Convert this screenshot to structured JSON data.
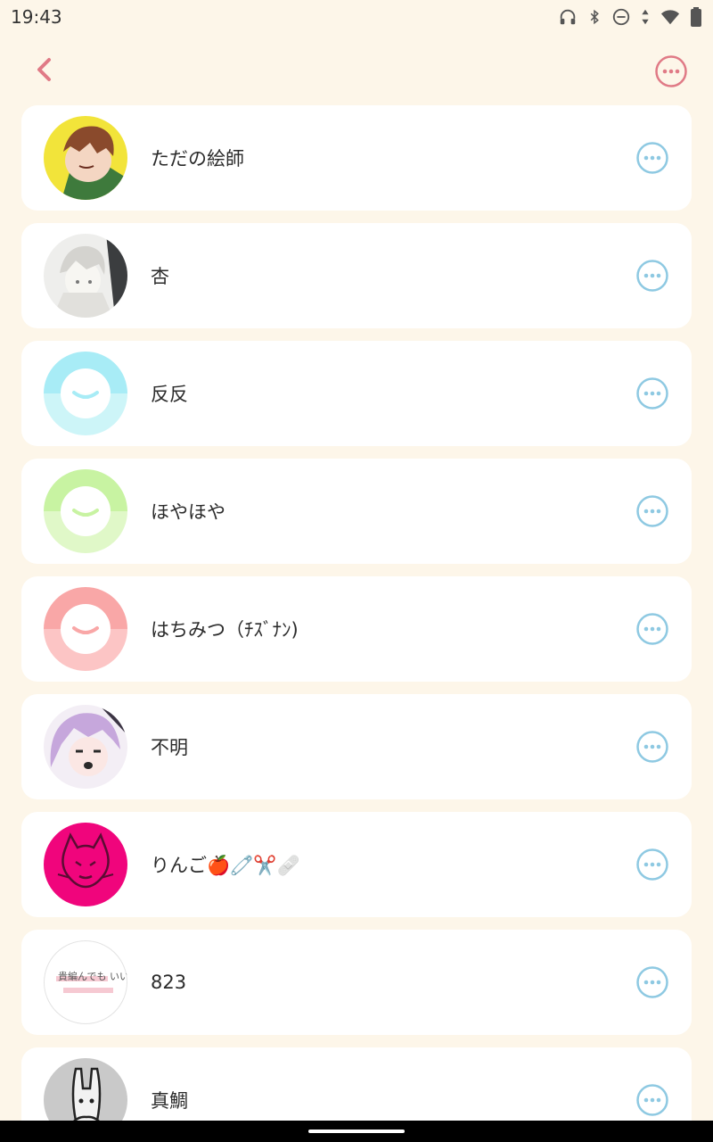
{
  "status_bar": {
    "time": "19:43",
    "icons": [
      "headphones-icon",
      "bluetooth-icon",
      "do-not-disturb-icon",
      "data-arrows-icon",
      "wifi-icon",
      "battery-icon"
    ]
  },
  "app_bar": {
    "back_icon": "chevron-left-icon",
    "more_icon": "more-options-icon",
    "accent_color": "#e07a86"
  },
  "row_action_color": "#8ec9e2",
  "users": [
    {
      "name": "ただの絵師",
      "avatar": "illustration-brown-hair"
    },
    {
      "name": "杏",
      "avatar": "illustration-monochrome-girl"
    },
    {
      "name": "反反",
      "avatar": "default-smiley-cyan"
    },
    {
      "name": "ほやほや",
      "avatar": "default-smiley-green"
    },
    {
      "name": "はちみつ（ﾁｽﾞﾅﾝ)",
      "avatar": "default-smiley-pink"
    },
    {
      "name": "不明",
      "avatar": "illustration-purple-hair"
    },
    {
      "name": "りんご🍎🧷✂️🩹",
      "avatar": "illustration-magenta-cat"
    },
    {
      "name": "823",
      "avatar": "handwritten-text",
      "avatar_text": "貴編んでも いいんだよ。"
    },
    {
      "name": "真鯛",
      "avatar": "drawing-rabbit"
    }
  ]
}
